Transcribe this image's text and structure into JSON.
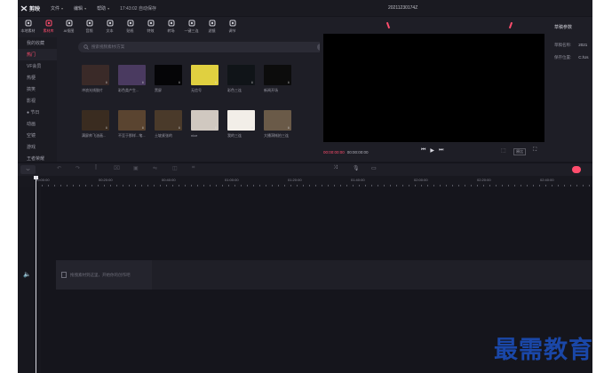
{
  "title_bar": {
    "app_name": "剪映",
    "menus": [
      "文件",
      "编辑",
      "帮助"
    ],
    "autosave_time": "17:43:02 自动保存",
    "project_name": "20211230174Z"
  },
  "toolbar": {
    "items": [
      {
        "label": "本地素材",
        "icon": "media-icon",
        "active": false
      },
      {
        "label": "素材库",
        "icon": "library-icon",
        "active": true
      },
      {
        "label": "AI抠图",
        "icon": "ai-icon",
        "active": false
      },
      {
        "label": "音频",
        "icon": "music-icon",
        "active": false
      },
      {
        "label": "文本",
        "icon": "text-icon",
        "active": false
      },
      {
        "label": "贴纸",
        "icon": "sticker-icon",
        "active": false
      },
      {
        "label": "特效",
        "icon": "effects-icon",
        "active": false
      },
      {
        "label": "转场",
        "icon": "transition-icon",
        "active": false
      },
      {
        "label": "一键三连",
        "icon": "thumbsup-icon",
        "active": false
      },
      {
        "label": "滤镜",
        "icon": "filter-icon",
        "active": false
      },
      {
        "label": "调节",
        "icon": "adjust-icon",
        "active": false
      }
    ]
  },
  "sidebar": {
    "items": [
      {
        "label": "我的收藏",
        "active": false
      },
      {
        "label": "热门",
        "active": true
      },
      {
        "label": "VF会员",
        "active": false
      },
      {
        "label": "热梗",
        "active": false
      },
      {
        "label": "搞笑",
        "active": false
      },
      {
        "label": "影视",
        "active": false
      },
      {
        "label": "● 节日",
        "active": false
      },
      {
        "label": "动画",
        "active": false
      },
      {
        "label": "空镜",
        "active": false
      },
      {
        "label": "游戏",
        "active": false
      },
      {
        "label": "王者荣耀",
        "active": false
      }
    ]
  },
  "search": {
    "placeholder": "搜索视频素材/方案",
    "clear_label": "×"
  },
  "library": {
    "rows": [
      [
        {
          "label": "冲浪光线胶片",
          "color": "#3a2a28"
        },
        {
          "label": "彩色类产生...",
          "color": "#4a3a60"
        },
        {
          "label": "黑屏",
          "color": "#050507"
        },
        {
          "label": "无信号",
          "color": "#e0d040"
        },
        {
          "label": "彩色三连",
          "color": "#101418"
        },
        {
          "label": "新闻开场",
          "color": "#0c0c0c"
        }
      ],
      [
        {
          "label": "满屏帅飞油画...",
          "color": "#3a2c20"
        },
        {
          "label": "不至于那样...笔...",
          "color": "#5a4430"
        },
        {
          "label": "土坡紧张的",
          "color": "#4a3a2a"
        },
        {
          "label": "nice",
          "color": "#d0c8c0"
        },
        {
          "label": "我的三连",
          "color": "#f2eee8"
        },
        {
          "label": "大播洞帐拍三连",
          "color": "#6a5a48"
        }
      ]
    ]
  },
  "player": {
    "current_time": "00:00:00:00",
    "total_time": "00:00:00:00",
    "original_label": "原比",
    "play_icon": "▶",
    "prev_icon": "⏮",
    "next_icon": "⏭",
    "fullscreen_icon": "⛶"
  },
  "draft_params": {
    "title": "草稿参数",
    "name_label": "草稿名称:",
    "name_value": "2021",
    "path_label": "保存位置:",
    "path_value": "C:/Us"
  },
  "timeline": {
    "ticks": [
      "00:00:00",
      "00:20:00",
      "00:40:00",
      "01:00:00",
      "01:20:00",
      "01:40:00",
      "02:00:00",
      "02:20:00",
      "02:40:00"
    ],
    "audio_drop_text": "拖拽素材到这里，开始你的创作吧"
  },
  "watermark": "最需教育",
  "colors": {
    "accent": "#ff4d6d",
    "bg": "#15151c",
    "panel": "#1e1e26",
    "watermark": "#1a47a8"
  }
}
